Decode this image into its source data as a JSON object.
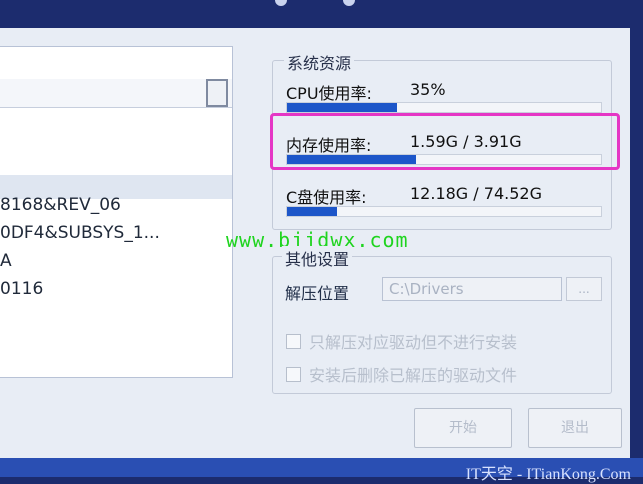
{
  "list": {
    "rows": [
      "8168&REV_06",
      "0DF4&SUBSYS_1...",
      "A",
      "0116"
    ]
  },
  "resources": {
    "title": "系统资源",
    "cpu": {
      "label": "CPU使用率:",
      "value": "35%",
      "fraction": 0.35
    },
    "memory": {
      "label": "内存使用率:",
      "value": "1.59G / 3.91G",
      "fraction": 0.41
    },
    "disk": {
      "label": "C盘使用率:",
      "value": "12.18G / 74.52G",
      "fraction": 0.16
    }
  },
  "watermark": "www.bjjdwx.com",
  "other_settings": {
    "title": "其他设置",
    "extract_label": "解压位置",
    "extract_path": "C:\\Drivers",
    "browse_label": "...",
    "opt1": "只解压对应驱动但不进行安装",
    "opt2": "安装后删除已解压的驱动文件"
  },
  "buttons": {
    "start": "开始",
    "exit": "退出"
  },
  "footer": {
    "brand": "IT天空 - ITianKong.Com"
  },
  "colors": {
    "accent": "#1d56c9",
    "highlight": "#e536c5",
    "watermark": "#1fd41f"
  }
}
